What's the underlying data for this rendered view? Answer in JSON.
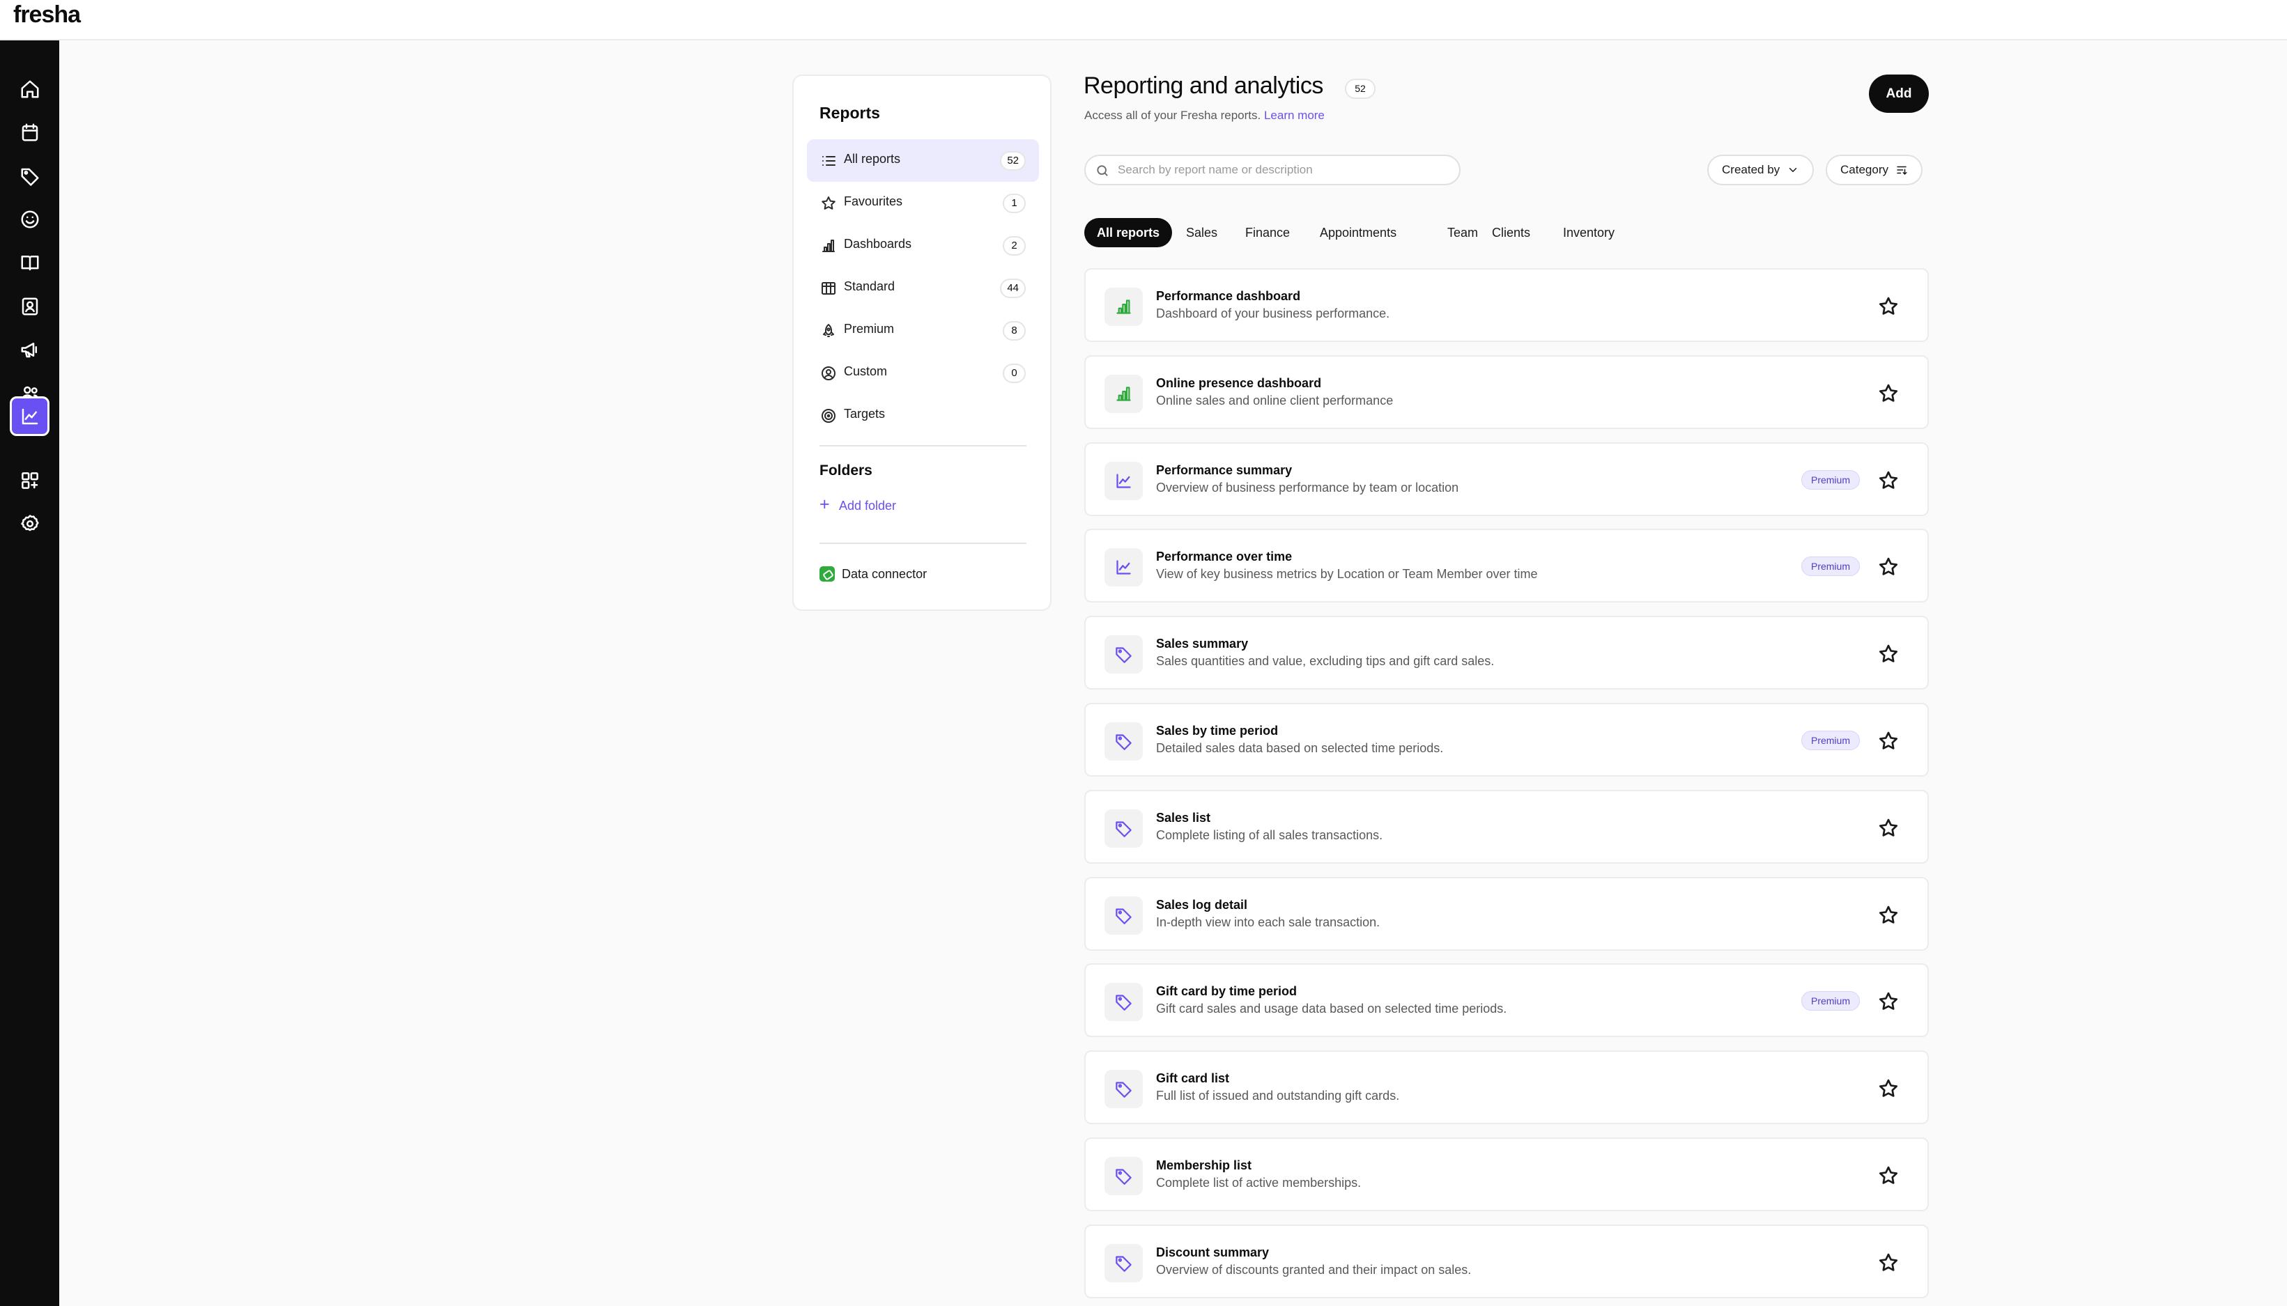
{
  "app": {
    "logo": "fresha"
  },
  "rail": {
    "items": [
      {
        "icon": "home-icon"
      },
      {
        "icon": "calendar-icon"
      },
      {
        "icon": "tag-icon"
      },
      {
        "icon": "smile-icon"
      },
      {
        "icon": "book-icon"
      },
      {
        "icon": "contact-card-icon"
      },
      {
        "icon": "megaphone-icon"
      },
      {
        "icon": "team-icon"
      },
      {
        "icon": "chart-line-icon",
        "active": true
      },
      {
        "icon": "add-apps-icon"
      },
      {
        "icon": "settings-icon"
      }
    ]
  },
  "sidebar": {
    "title": "Reports",
    "items": [
      {
        "label": "All reports",
        "count": "52",
        "icon": "list-icon",
        "active": true
      },
      {
        "label": "Favourites",
        "count": "1",
        "icon": "star-icon"
      },
      {
        "label": "Dashboards",
        "count": "2",
        "icon": "bar-chart-icon"
      },
      {
        "label": "Standard",
        "count": "44",
        "icon": "table-icon"
      },
      {
        "label": "Premium",
        "count": "8",
        "icon": "rocket-icon"
      },
      {
        "label": "Custom",
        "count": "0",
        "icon": "user-circle-icon"
      },
      {
        "label": "Targets",
        "count": "",
        "icon": "target-icon"
      }
    ],
    "folders_title": "Folders",
    "add_folder_label": "Add folder",
    "data_connector_label": "Data connector"
  },
  "header": {
    "title": "Reporting and analytics",
    "count": "52",
    "subtitle": "Access all of your Fresha reports.",
    "learn_more": "Learn more",
    "add_label": "Add"
  },
  "search": {
    "placeholder": "Search by report name or description",
    "value": ""
  },
  "filters": {
    "created_by_label": "Created by",
    "category_label": "Category"
  },
  "tabs": [
    {
      "label": "All reports",
      "active": true
    },
    {
      "label": "Sales"
    },
    {
      "label": "Finance"
    },
    {
      "label": "Appointments"
    },
    {
      "label": "Team"
    },
    {
      "label": "Clients"
    },
    {
      "label": "Inventory"
    }
  ],
  "premium_label": "Premium",
  "colors": {
    "accent": "#6950f3",
    "dashboard_icon": "#2faa3c",
    "rail": "#0d0d0d"
  },
  "reports": [
    {
      "name": "Performance dashboard",
      "description": "Dashboard of your business performance.",
      "icon": "bar-chart-icon",
      "premium": false
    },
    {
      "name": "Online presence dashboard",
      "description": "Online sales and online client performance",
      "icon": "bar-chart-icon",
      "premium": false
    },
    {
      "name": "Performance summary",
      "description": "Overview of business performance by team or location",
      "icon": "trend-line-icon",
      "premium": true
    },
    {
      "name": "Performance over time",
      "description": "View of key business metrics by Location or Team Member over time",
      "icon": "trend-line-icon",
      "premium": true
    },
    {
      "name": "Sales summary",
      "description": "Sales quantities and value, excluding tips and gift card sales.",
      "icon": "tag-icon",
      "premium": false
    },
    {
      "name": "Sales by time period",
      "description": "Detailed sales data based on selected time periods.",
      "icon": "tag-icon",
      "premium": true
    },
    {
      "name": "Sales list",
      "description": "Complete listing of all sales transactions.",
      "icon": "tag-icon",
      "premium": false
    },
    {
      "name": "Sales log detail",
      "description": "In-depth view into each sale transaction.",
      "icon": "tag-icon",
      "premium": false
    },
    {
      "name": "Gift card by time period",
      "description": "Gift card sales and usage data based on selected time periods.",
      "icon": "tag-icon",
      "premium": true
    },
    {
      "name": "Gift card list",
      "description": "Full list of issued and outstanding gift cards.",
      "icon": "tag-icon",
      "premium": false
    },
    {
      "name": "Membership list",
      "description": "Complete list of active memberships.",
      "icon": "tag-icon",
      "premium": false
    },
    {
      "name": "Discount summary",
      "description": "Overview of discounts granted and their impact on sales.",
      "icon": "tag-icon",
      "premium": false
    }
  ]
}
